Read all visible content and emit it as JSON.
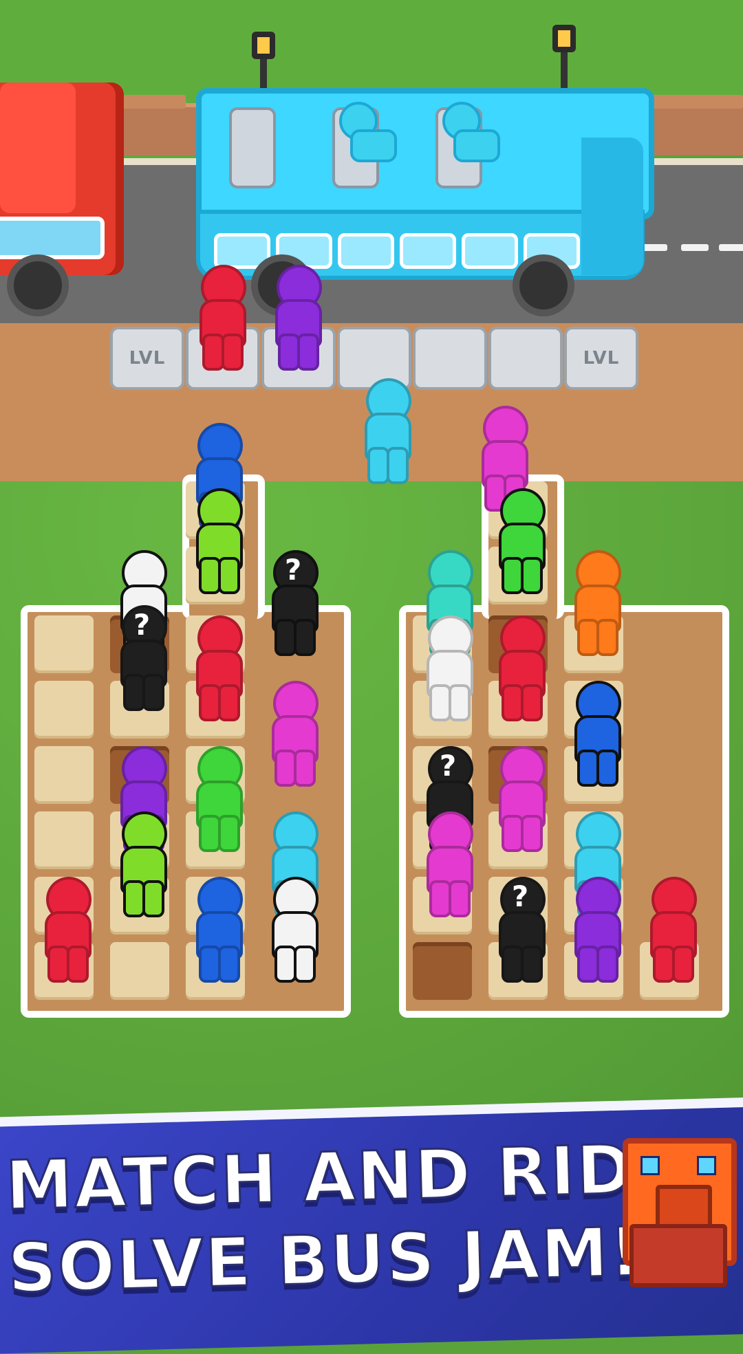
{
  "game": {
    "headline_line1": "MATCH AND RIDE",
    "headline_line2": "SOLVE BUS JAM!",
    "locked_spot_label": "LVL",
    "unknown_marker": "?"
  },
  "colors": {
    "red": "#e8223c",
    "purple": "#8b2ddb",
    "blue": "#1e63e0",
    "lime": "#7fdd2a",
    "white": "#f3f3f3",
    "black": "#1f1f1f",
    "magenta": "#e53ad0",
    "cyan": "#3cd1ef",
    "orange": "#ff7a1a",
    "teal": "#38d9c4",
    "green": "#3ed63a"
  },
  "waiting_spots": [
    {
      "state": "locked"
    },
    {
      "state": "occupied",
      "person": "red"
    },
    {
      "state": "occupied",
      "person": "purple"
    },
    {
      "state": "empty"
    },
    {
      "state": "empty"
    },
    {
      "state": "empty"
    },
    {
      "state": "locked"
    }
  ],
  "bus": {
    "color": "cyan",
    "seats": 3,
    "filled": 2
  },
  "runners": [
    {
      "color": "cyan"
    },
    {
      "color": "magenta"
    }
  ]
}
